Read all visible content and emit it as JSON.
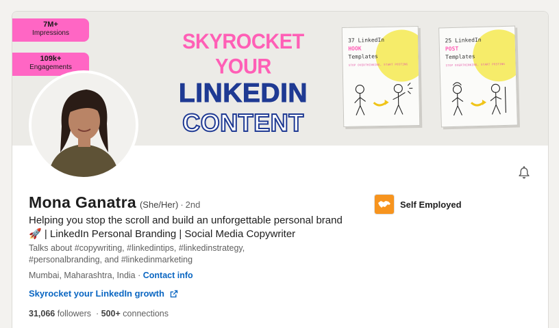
{
  "banner": {
    "stats": [
      {
        "value": "7M+",
        "label": "Impressions"
      },
      {
        "value": "109k+",
        "label": "Engagements"
      }
    ],
    "headline": {
      "line1": "SKYROCKET YOUR",
      "line2": "LINKEDIN",
      "line3": "CONTENT"
    },
    "books": [
      {
        "title_pre": "37 LinkedIn",
        "title_key": "HOOK",
        "title_post": "Templates",
        "subtitle": "STOP OVERTHINKING, START POSTING"
      },
      {
        "title_pre": "25 LinkedIn",
        "title_key": "POST",
        "title_post": "Templates",
        "subtitle": "STOP OVERTHINKING, START POSTING"
      }
    ],
    "colors": {
      "pink": "#ff5fb6",
      "navy": "#1f3a93",
      "yellow": "#f6ec6a"
    }
  },
  "profile": {
    "name": "Mona Ganatra",
    "pronouns": "(She/Her)",
    "separator": "·",
    "degree": "2nd",
    "headline": "Helping you stop the scroll and build an unforgettable personal brand 🚀 | LinkedIn Personal Branding | Social Media Copywriter",
    "talks_about": "Talks about #copywriting, #linkedintips, #linkedinstrategy, #personalbranding, and #linkedinmarketing",
    "location": "Mumbai, Maharashtra, India",
    "location_separator": " · ",
    "contact_info": "Contact info",
    "external_link": "Skyrocket your LinkedIn growth",
    "followers_count": "31,066",
    "followers_label": "followers",
    "conn_separator": "·",
    "connections_count": "500+",
    "connections_label": "connections"
  },
  "company": {
    "name": "Self Employed",
    "logo_color": "#f7941e"
  },
  "icons": {
    "bell": "bell-icon",
    "external": "external-link-icon",
    "company_logo": "handshake-icon"
  },
  "accent": "#0a66c2"
}
